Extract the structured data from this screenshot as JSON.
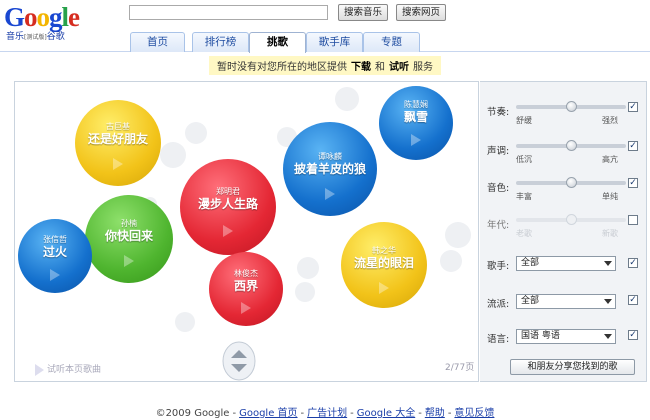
{
  "logo": {
    "word": "Google",
    "sub_cn": "音乐",
    "sub_beta": "[测试版]",
    "sub_cn2": "谷歌"
  },
  "search": {
    "value": "",
    "buttons": [
      "搜索音乐",
      "搜索网页"
    ]
  },
  "tabs": [
    {
      "label": "首页"
    },
    {
      "label": "排行榜"
    },
    {
      "label": "挑歌",
      "active": true
    },
    {
      "label": "歌手库"
    },
    {
      "label": "专题"
    }
  ],
  "notice": {
    "pre": "暂时没有对您所在的地区提供",
    "b1": "下载",
    "mid": "和",
    "b2": "试听",
    "post": "服务"
  },
  "songs": [
    {
      "artist": "陈慧娴",
      "title": "飘雪",
      "color": "blue"
    },
    {
      "artist": "古巨基",
      "title": "还是好朋友",
      "color": "yellow"
    },
    {
      "artist": "谭咏麟",
      "title": "披着羊皮的狼",
      "color": "blue"
    },
    {
      "artist": "郑明君",
      "title": "漫步人生路",
      "color": "red"
    },
    {
      "artist": "孙楠",
      "title": "你快回来",
      "color": "green"
    },
    {
      "artist": "张信哲",
      "title": "过火",
      "color": "blue"
    },
    {
      "artist": "林俊杰",
      "title": "西界",
      "color": "red"
    },
    {
      "artist": "韩之华",
      "title": "流星的眼泪",
      "color": "yellow"
    }
  ],
  "listen_page": "试听本页歌曲",
  "page_indicator": "2/77页",
  "filters": {
    "sliders": [
      {
        "label": "节奏:",
        "min": "舒缓",
        "max": "强烈",
        "level": 0.5,
        "checked": true,
        "enabled": true
      },
      {
        "label": "声调:",
        "min": "低沉",
        "max": "高亢",
        "level": 0.5,
        "checked": true,
        "enabled": true
      },
      {
        "label": "音色:",
        "min": "丰富",
        "max": "单纯",
        "level": 0.5,
        "checked": true,
        "enabled": true
      },
      {
        "label": "年代:",
        "min": "老歌",
        "max": "新歌",
        "level": 0.5,
        "checked": false,
        "enabled": false
      }
    ],
    "selects": [
      {
        "label": "歌手:",
        "value": "全部",
        "checked": true
      },
      {
        "label": "流派:",
        "value": "全部",
        "checked": true
      },
      {
        "label": "语言:",
        "value": "国语 粤语",
        "checked": true
      }
    ],
    "share_button": "和朋友分享您找到的歌"
  },
  "footer": {
    "copyright": "©2009 Google",
    "links": [
      "Google 首页",
      "广告计划",
      "Google 大全",
      "帮助",
      "意见反馈"
    ]
  },
  "colors": {
    "tab_text": "#1f4da1",
    "notice_bg": "#fff8c4",
    "link": "#1a3ea8"
  }
}
